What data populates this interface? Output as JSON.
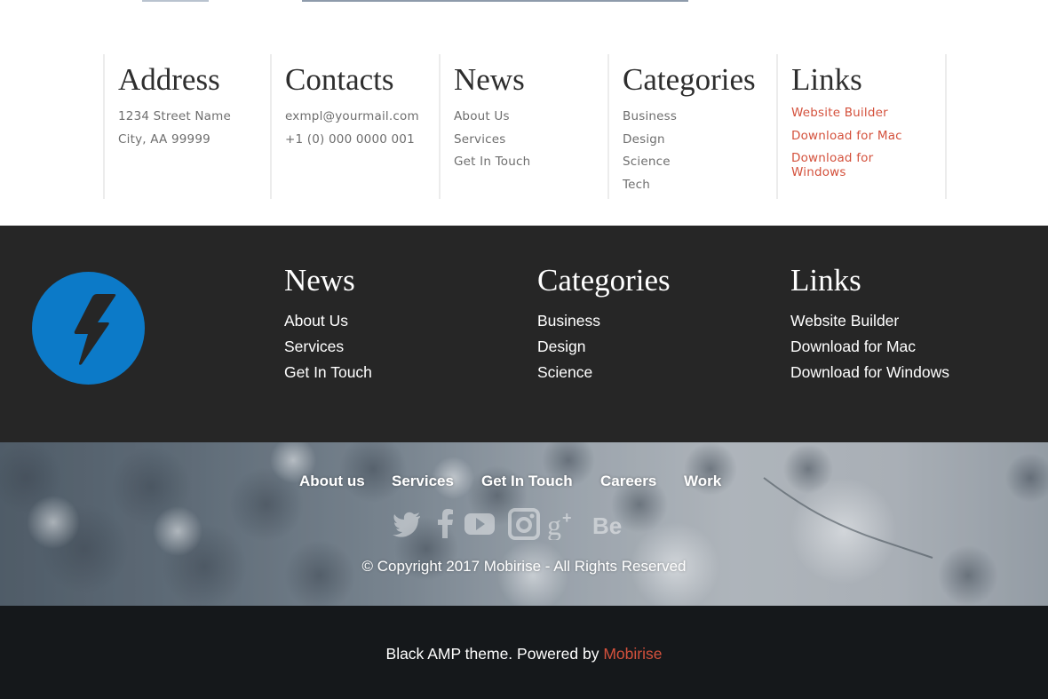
{
  "top_section": {
    "address": {
      "title": "Address",
      "lines": [
        "1234 Street Name",
        "City, AA 99999"
      ]
    },
    "contacts": {
      "title": "Contacts",
      "lines": [
        "exmpl@yourmail.com",
        "+1 (0) 000 0000 001"
      ]
    },
    "news": {
      "title": "News",
      "items": [
        "About Us",
        "Services",
        "Get In Touch"
      ]
    },
    "categories": {
      "title": "Categories",
      "items": [
        "Business",
        "Design",
        "Science",
        "Tech"
      ]
    },
    "links": {
      "title": "Links",
      "items": [
        "Website Builder",
        "Download for Mac",
        "Download for Windows"
      ],
      "color": "#d4513c"
    }
  },
  "dark_footer": {
    "logo_icon": "lightning-bolt-icon",
    "logo_color": "#0c7ac8",
    "news": {
      "title": "News",
      "items": [
        "About Us",
        "Services",
        "Get In Touch"
      ]
    },
    "categories": {
      "title": "Categories",
      "items": [
        "Business",
        "Design",
        "Science"
      ]
    },
    "links": {
      "title": "Links",
      "items": [
        "Website Builder",
        "Download for Mac",
        "Download for Windows"
      ]
    }
  },
  "image_footer": {
    "nav": [
      "About us",
      "Services",
      "Get In Touch",
      "Careers",
      "Work"
    ],
    "social": [
      "twitter-icon",
      "facebook-icon",
      "youtube-icon",
      "instagram-icon",
      "google-plus-icon",
      "behance-icon"
    ],
    "copyright": "© Copyright 2017 Mobirise - All Rights Reserved"
  },
  "bottom_bar": {
    "text": "Black AMP theme. Powered by",
    "link": "Mobirise",
    "link_color": "#d4513c"
  }
}
